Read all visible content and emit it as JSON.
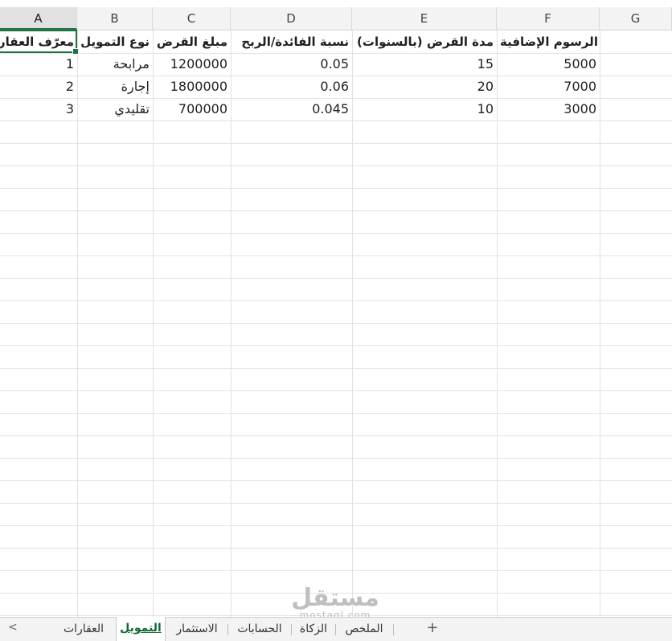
{
  "spreadsheet": {
    "columns": [
      "A",
      "B",
      "C",
      "D",
      "E",
      "F",
      "G"
    ],
    "selected_column": "A",
    "headers": [
      "معرّف العقار",
      "نوع التمويل",
      "مبلغ القرض",
      "نسبة الفائدة/الربح",
      "مدة القرض (بالسنوات)",
      "الرسوم الإضافية"
    ],
    "rows": [
      [
        "1",
        "مرابحة",
        "1200000",
        "0.05",
        "15",
        "5000"
      ],
      [
        "2",
        "إجارة",
        "1800000",
        "0.06",
        "20",
        "7000"
      ],
      [
        "3",
        "تقليدي",
        "700000",
        "0.045",
        "10",
        "3000"
      ]
    ]
  },
  "tabs": {
    "nav_icon": "chevron-left-icon",
    "nav_glyph": "<",
    "items": [
      "العقارات",
      "التمويل",
      "الاستثمار",
      "الحسابات",
      "الزكاة",
      "الملخص"
    ],
    "active": "التمويل",
    "add_label": "+"
  },
  "watermark": {
    "brand": "مستقل",
    "site": "mostaql.com"
  },
  "colors": {
    "accent": "#217346",
    "active_tab_text": "#0f6b37",
    "grid_line": "#e2e2e2",
    "header_bg": "#f3f3f3"
  }
}
